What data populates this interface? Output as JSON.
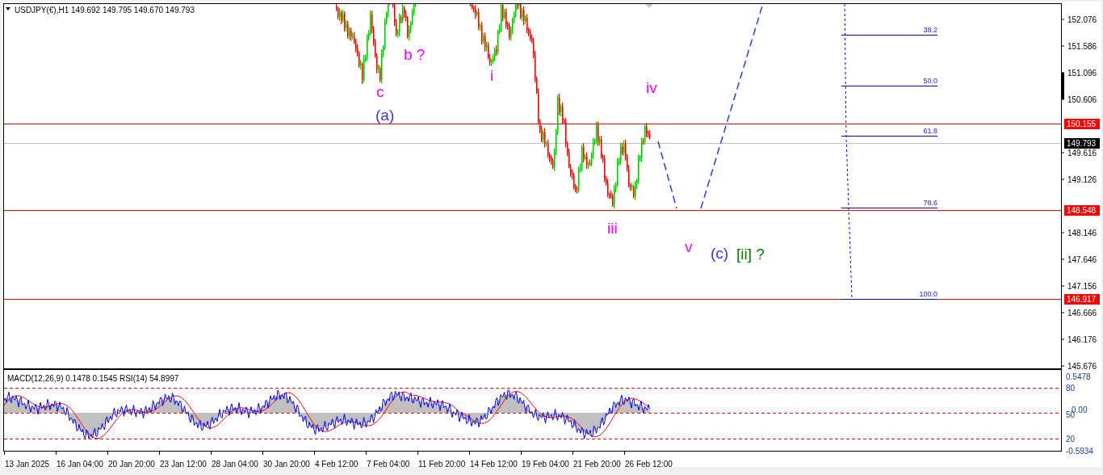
{
  "chart": {
    "header": "USDJPY(€),H1  149.692 149.795 149.670 149.793"
  },
  "price_axis": {
    "labels": [
      "152.076",
      "151.586",
      "151.096",
      "150.606",
      "149.616",
      "149.126",
      "148.146",
      "147.646",
      "147.156",
      "146.666",
      "146.176",
      "145.676"
    ]
  },
  "price_tags": [
    {
      "text": "150.155",
      "kind": "level"
    },
    {
      "text": "149.793",
      "kind": "bid"
    },
    {
      "text": "148.548",
      "kind": "level"
    },
    {
      "text": "146.917",
      "kind": "level"
    }
  ],
  "wave_labels": [
    {
      "text": "b ?",
      "color": "#ff00ff"
    },
    {
      "text": "c",
      "color": "#ff00ff"
    },
    {
      "text": "(a)",
      "color": "#3333ff"
    },
    {
      "text": "i",
      "color": "#ff00ff"
    },
    {
      "text": "iv",
      "color": "#ff00ff"
    },
    {
      "text": "iii",
      "color": "#ff00ff"
    },
    {
      "text": "v",
      "color": "#ff00ff"
    },
    {
      "text": "(c)",
      "color": "#3333ff"
    },
    {
      "text": "[ii] ?",
      "color": "#008000"
    }
  ],
  "fibonacci": {
    "levels": [
      "38.2",
      "50.0",
      "61.8",
      "78.6",
      "100.0"
    ]
  },
  "indicator": {
    "header": "MACD(12,26,9) 0.1478 0.1545  RSI(14) 54.8997",
    "axis_labels": [
      "0.5478",
      "80",
      "0.00",
      "50",
      "20",
      "-0.5934"
    ]
  },
  "time_axis": {
    "labels": [
      "13 Jan 2025",
      "16 Jan 04:00",
      "20 Jan 20:00",
      "23 Jan 12:00",
      "28 Jan 04:00",
      "30 Jan 20:00",
      "4 Feb 12:00",
      "7 Feb 04:00",
      "11 Feb 20:00",
      "14 Feb 12:00",
      "19 Feb 04:00",
      "21 Feb 20:00",
      "26 Feb 12:00"
    ]
  }
}
